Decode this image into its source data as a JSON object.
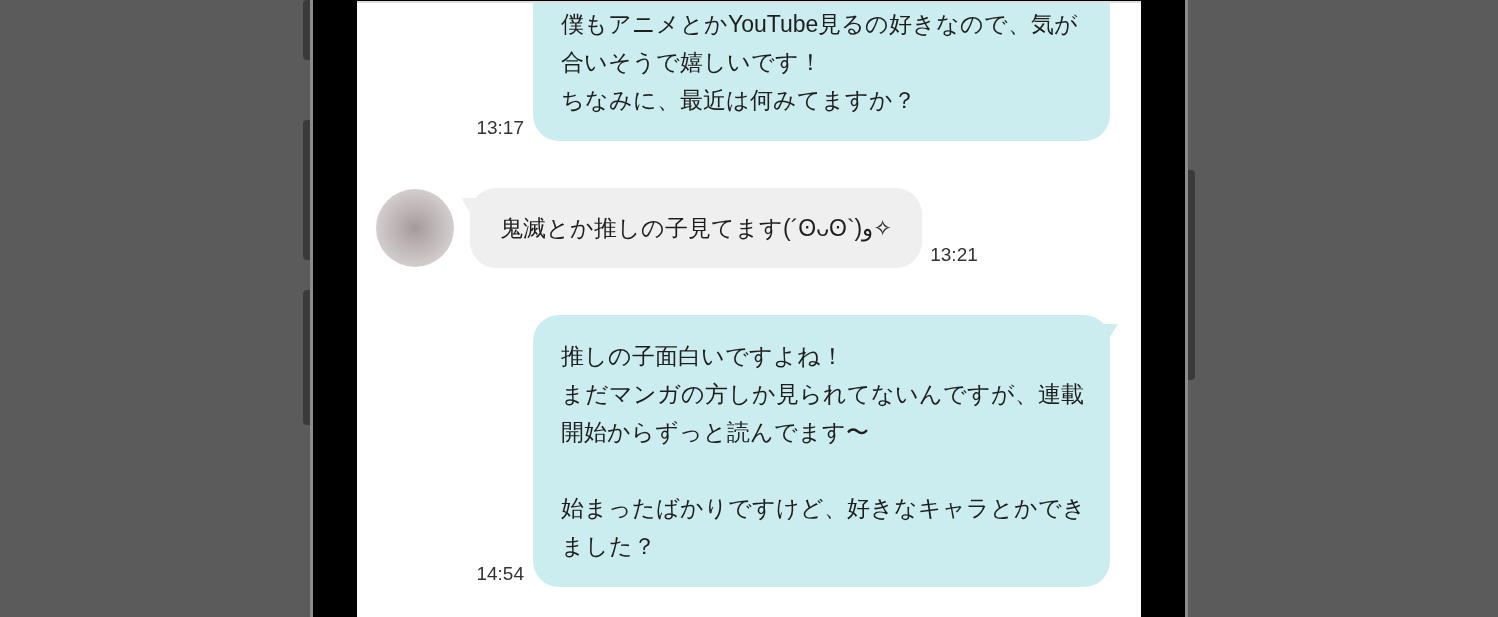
{
  "messages": [
    {
      "kind": "sent",
      "paragraphs": [
        [
          "僕もアニメとかYouTube見るの好きなので、気が合いそうで嬉しいです！",
          "ちなみに、最近は何みてますか？"
        ]
      ],
      "time": "13:17",
      "tail": false,
      "cut_top": true
    },
    {
      "kind": "received",
      "paragraphs": [
        [
          "鬼滅とか推しの子見てます(´ʘᴗʘ`)و✧"
        ]
      ],
      "time": "13:21",
      "tail": true,
      "cut_top": false
    },
    {
      "kind": "sent",
      "paragraphs": [
        [
          "推しの子面白いですよね！",
          "まだマンガの方しか見られてないんですが、連載開始からずっと読んでます〜"
        ],
        [
          "始まったばかりですけど、好きなキャラとかできました？"
        ]
      ],
      "time": "14:54",
      "tail": true,
      "cut_top": false
    }
  ]
}
